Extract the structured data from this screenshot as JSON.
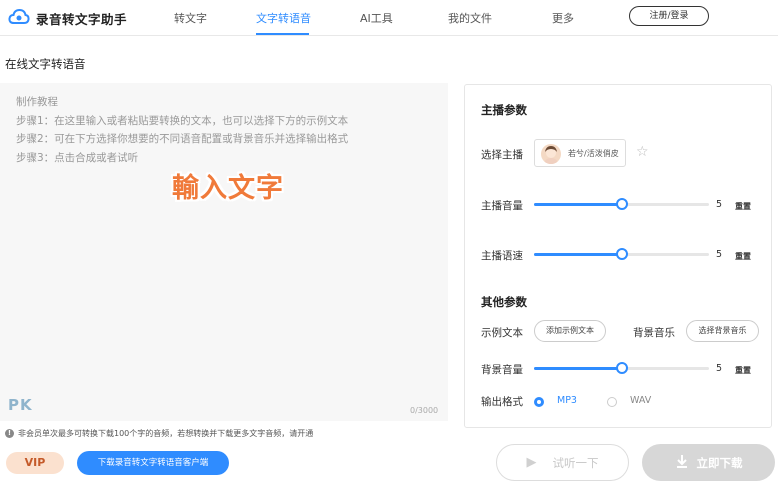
{
  "app": {
    "title": "录音转文字助手"
  },
  "nav": {
    "items": [
      {
        "label": "转文字"
      },
      {
        "label": "文字转语音"
      },
      {
        "label": "AI工具"
      },
      {
        "label": "我的文件"
      },
      {
        "label": "更多"
      }
    ],
    "active_index": 1,
    "login_label": "注册/登录"
  },
  "page": {
    "title": "在线文字转语音"
  },
  "editor": {
    "lines": [
      "制作教程",
      "步骤1：在这里输入或者粘贴要转换的文本，也可以选择下方的示例文本",
      "步骤2：可在下方选择你想要的不同语音配置或背景音乐并选择输出格式",
      "步骤3：点击合成或者试听"
    ],
    "overlay_text": "輸入文字",
    "watermark": "PK",
    "counter": "0/3000"
  },
  "panel": {
    "anchor_section_title": "主播参数",
    "select_anchor_label": "选择主播",
    "anchor_name": "若兮/活泼俏皮",
    "volume_label": "主播音量",
    "volume_value": "5",
    "volume_level": 0.5,
    "speed_label": "主播语速",
    "speed_value": "5",
    "speed_level": 0.5,
    "reset_label": "重置",
    "other_section_title": "其他参数",
    "sample_text_label": "示例文本",
    "add_sample_button": "添加示例文本",
    "bg_music_label": "背景音乐",
    "choose_bg_button": "选择背景音乐",
    "bg_volume_label": "背景音量",
    "bg_volume_value": "5",
    "bg_volume_level": 0.5,
    "format_label": "输出格式",
    "formats": [
      {
        "label": "MP3",
        "selected": true
      },
      {
        "label": "WAV",
        "selected": false
      }
    ]
  },
  "footer": {
    "notice": "非会员单次最多可转换下载100个字的音频，若想转换并下载更多文字音频，请开通",
    "vip_label": "VIP",
    "download_client_label": "下载录音转文字转语音客户端",
    "try_listen_label": "试听一下",
    "download_now_label": "立即下载"
  },
  "colors": {
    "accent": "#2f8cff",
    "overlay": "#f07a3a"
  }
}
